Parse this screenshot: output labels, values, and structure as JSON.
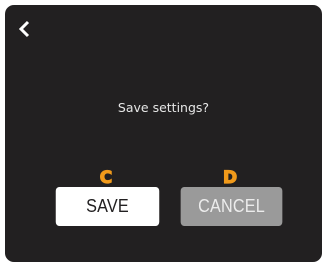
{
  "dialog": {
    "message": "Save settings?"
  },
  "navigation": {
    "back_icon": "chevron-left-icon"
  },
  "buttons": {
    "save": {
      "label": "SAVE",
      "hint_key": "C"
    },
    "cancel": {
      "label": "CANCEL",
      "hint_key": "D"
    }
  },
  "colors": {
    "background": "#222021",
    "hint_key": "#f19a1b",
    "save_button": "#ffffff",
    "cancel_button": "#9a9a9a",
    "text": "#e6e6e6"
  }
}
